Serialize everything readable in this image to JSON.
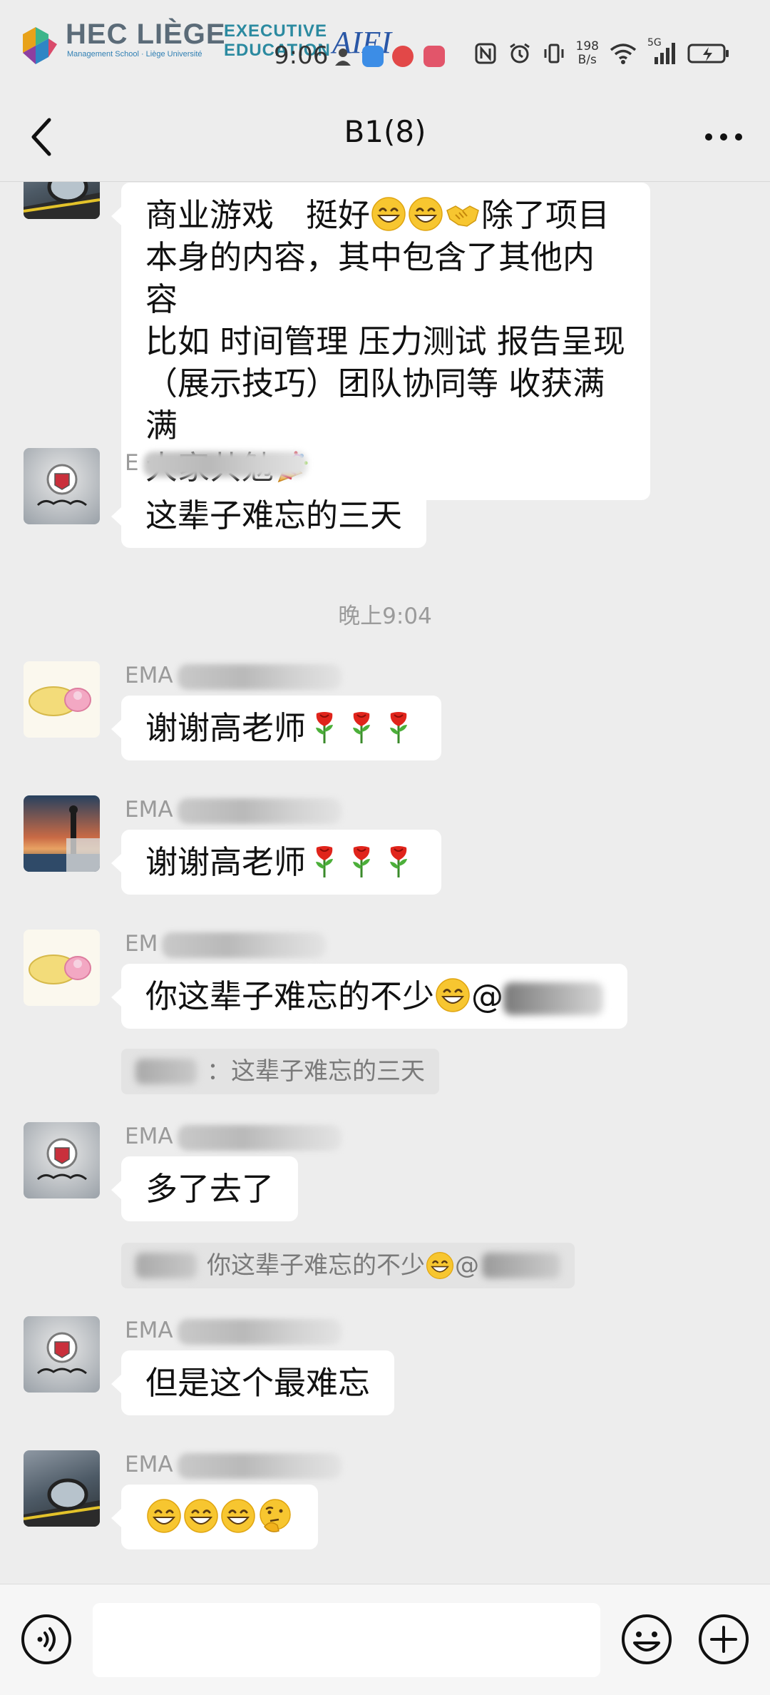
{
  "status_bar": {
    "logo_brand": "HEC LIÈGE",
    "logo_subtitle": "Management School · Liège Université",
    "logo_exec_line1": "EXECUTIVE",
    "logo_exec_line2": "EDUCATION",
    "logo_aiei": "AIEI",
    "time": "9:06",
    "net_speed_value": "198",
    "net_speed_unit": "B/s",
    "network_type": "5G"
  },
  "header": {
    "title": "B1(8)"
  },
  "messages": [
    {
      "avatar": "car-mirror-photo",
      "text_parts": [
        "商业游戏　挺好",
        "除了项目本身的内容，其中包含了其他内容 比如 时间管理 压力测试 报告呈现（展示技巧）团队协同等 收获满满 大家共勉"
      ],
      "lines": [
        "商业游戏　挺好",
        "本身的内容，其中包含了其他内容",
        "比如  时间管理 压力测试 报告呈现",
        "（展示技巧）团队协同等 收获满满",
        "大家共勉"
      ],
      "line1_tail": "除了项目"
    },
    {
      "avatar": "cadillac-logo",
      "sender_prefix": "E",
      "text": "这辈子难忘的三天"
    },
    {
      "avatar": "peanut-slippers",
      "sender_prefix": "EMA",
      "text": "谢谢高老师"
    },
    {
      "avatar": "sunset-photo",
      "sender_prefix": "EMA",
      "text": "谢谢高老师"
    },
    {
      "avatar": "peanut-slippers",
      "sender_prefix": "EM",
      "text": "你这辈子难忘的不少",
      "mention": "@",
      "quote": "这辈子难忘的三天",
      "quote_sep": "："
    },
    {
      "avatar": "cadillac-logo",
      "sender_prefix": "EMA",
      "text": "多了去了",
      "quote": "你这辈子难忘的不少",
      "quote_mention": "@"
    },
    {
      "avatar": "cadillac-logo",
      "sender_prefix": "EMA",
      "text": "但是这个最难忘"
    },
    {
      "avatar": "car-mirror-photo",
      "sender_prefix": "EMA",
      "text": ""
    }
  ],
  "timestamp": "晚上9:04",
  "input_bar": {
    "placeholder": "",
    "voice_icon": "voice-icon",
    "emoji_icon": "emoji-icon",
    "plus_icon": "plus-icon"
  },
  "colors": {
    "background": "#ededed",
    "bubble": "#ffffff",
    "quote_bg": "#e3e3e3",
    "timestamp": "#9b9b9b"
  }
}
